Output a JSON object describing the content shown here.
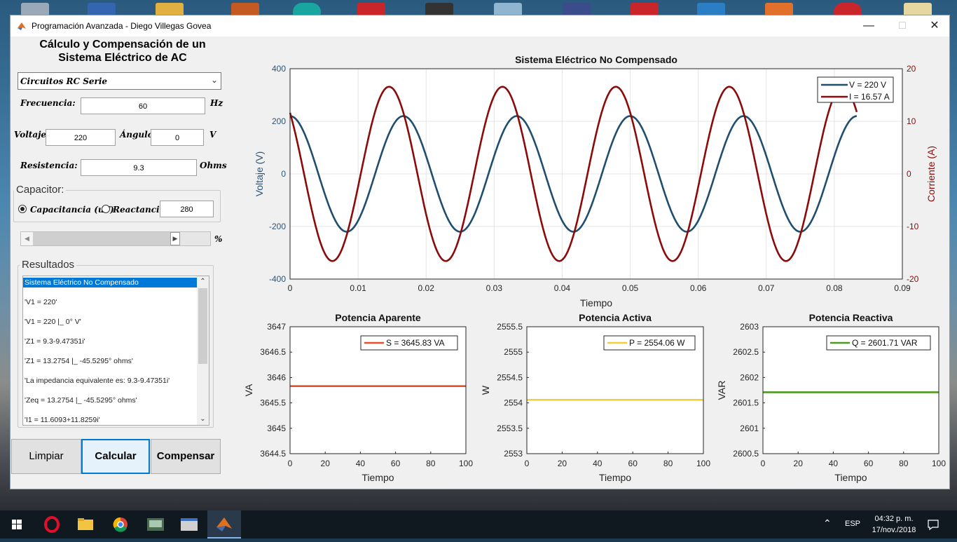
{
  "window": {
    "title": "Programación Avanzada - Diego Villegas Govea"
  },
  "app": {
    "heading_line1": "Cálculo y Compensación de un",
    "heading_line2": "Sistema Eléctrico de AC",
    "circuit_select": "Circuitos RC Serie",
    "frecuencia_label": "Frecuencia:",
    "frecuencia_value": "60",
    "frecuencia_unit": "Hz",
    "voltaje_label": "Voltaje:",
    "voltaje_value": "220",
    "angulo_label": "Ángulo:",
    "angulo_value": "0",
    "voltaje_unit": "V",
    "resistencia_label": "Resistencia:",
    "resistencia_value": "9.3",
    "resistencia_unit": "Ohms",
    "capacitor_title": "Capacitor:",
    "radio_capacitancia": "Capacitancia (uF)",
    "radio_reactancia": "Reactancia",
    "capacitor_value": "280",
    "slider_unit": "%",
    "resultados_title": "Resultados",
    "results": [
      "Sistema Eléctrico No Compensado",
      "'V1 = 220'",
      "'V1 = 220 |_ 0° V'",
      "'Z1 = 9.3-9.47351i'",
      "'Z1 = 13.2754 |_ -45.5295° ohms'",
      "'La impedancia equivalente es: 9.3-9.47351i'",
      "'Zeq = 13.2754 |_ -45.5295° ohms'",
      "'I1 = 11.6093+11.8259i'"
    ],
    "btn_limpiar": "Limpiar",
    "btn_calcular": "Calcular",
    "btn_compensar": "Compensar"
  },
  "chart_data": [
    {
      "type": "line",
      "title": "Sistema Eléctrico No Compensado",
      "xlabel": "Tiempo",
      "ylabel": "Voltaje (V)",
      "ylabel_right": "Corriente (A)",
      "xlim": [
        0,
        0.09
      ],
      "ylim": [
        -400,
        400
      ],
      "ylim_right": [
        -20,
        20
      ],
      "xticks": [
        "0",
        "0.01",
        "0.02",
        "0.03",
        "0.04",
        "0.05",
        "0.06",
        "0.07",
        "0.08",
        "0.09"
      ],
      "yticks": [
        "400",
        "200",
        "0",
        "-200",
        "-400"
      ],
      "yticks_right": [
        "20",
        "10",
        "0",
        "-10",
        "-20"
      ],
      "grid": true,
      "legend": "top-right",
      "series": [
        {
          "name": "V = 220 V",
          "axis": "left",
          "amplitude": 220,
          "frequency_hz": 60,
          "phase_deg": 0,
          "x_range": [
            0,
            0.0833
          ],
          "color": "#1f4e6e"
        },
        {
          "name": "I = 16.57 A",
          "axis": "right",
          "amplitude": 16.57,
          "frequency_hz": 60,
          "phase_deg": 45.53,
          "x_range": [
            0,
            0.0833
          ],
          "color": "#8b0a0a"
        }
      ]
    },
    {
      "type": "line",
      "title": "Potencia Aparente",
      "xlabel": "Tiempo",
      "ylabel": "VA",
      "xlim": [
        0,
        100
      ],
      "ylim": [
        3644.5,
        3647
      ],
      "xticks": [
        "0",
        "20",
        "40",
        "60",
        "80",
        "100"
      ],
      "yticks": [
        "3647",
        "3646.5",
        "3646",
        "3645.5",
        "3645",
        "3644.5"
      ],
      "legend": "top-right",
      "series": [
        {
          "name": "S = 3645.83 VA",
          "x": [
            0,
            100
          ],
          "y": [
            3645.83,
            3645.83
          ],
          "color": "#e8502d"
        }
      ]
    },
    {
      "type": "line",
      "title": "Potencia Activa",
      "xlabel": "Tiempo",
      "ylabel": "W",
      "xlim": [
        0,
        100
      ],
      "ylim": [
        2553,
        2555.5
      ],
      "xticks": [
        "0",
        "20",
        "40",
        "60",
        "80",
        "100"
      ],
      "yticks": [
        "2555.5",
        "2555",
        "2554.5",
        "2554",
        "2553.5",
        "2553"
      ],
      "legend": "top-right",
      "series": [
        {
          "name": "P = 2554.06 W",
          "x": [
            0,
            100
          ],
          "y": [
            2554.06,
            2554.06
          ],
          "color": "#f2cf3a"
        }
      ]
    },
    {
      "type": "line",
      "title": "Potencia Reactiva",
      "xlabel": "Tiempo",
      "ylabel": "VAR",
      "xlim": [
        0,
        100
      ],
      "ylim": [
        2600.5,
        2603
      ],
      "xticks": [
        "0",
        "20",
        "40",
        "60",
        "80",
        "100"
      ],
      "yticks": [
        "2603",
        "2602.5",
        "2602",
        "2601.5",
        "2601",
        "2600.5"
      ],
      "legend": "top-right",
      "series": [
        {
          "name": "Q = 2601.71 VAR",
          "x": [
            0,
            100
          ],
          "y": [
            2601.71,
            2601.71
          ],
          "color": "#4d9a1d"
        }
      ]
    }
  ],
  "taskbar": {
    "lang": "ESP",
    "time": "04:32 p. m.",
    "date": "17/nov./2018"
  }
}
